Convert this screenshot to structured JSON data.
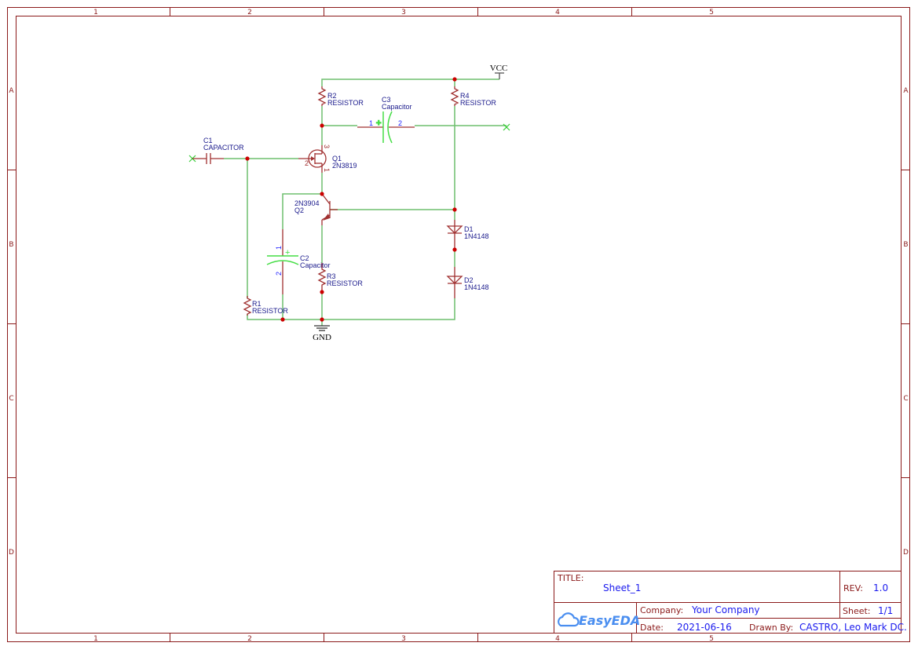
{
  "frame": {
    "columns": [
      "1",
      "2",
      "3",
      "4",
      "5"
    ],
    "rows": [
      "A",
      "B",
      "C",
      "D"
    ]
  },
  "colors": {
    "wire": "#6fbf6f",
    "part": "#a03030",
    "junction": "#cc0000",
    "label": "#1a1a8c",
    "frame": "#8b1a1a"
  },
  "nets": {
    "vcc": "VCC",
    "gnd": "GND"
  },
  "components": {
    "r1": {
      "ref": "R1",
      "value": "RESISTOR"
    },
    "r2": {
      "ref": "R2",
      "value": "RESISTOR"
    },
    "r3": {
      "ref": "R3",
      "value": "RESISTOR"
    },
    "r4": {
      "ref": "R4",
      "value": "RESISTOR"
    },
    "c1": {
      "ref": "C1",
      "value": "CAPACITOR"
    },
    "c2": {
      "ref": "C2",
      "value": "Capacitor",
      "pin1": "1",
      "pin2": "2",
      "plus": "+"
    },
    "c3": {
      "ref": "C3",
      "value": "Capacitor",
      "pin1": "1",
      "pin2": "2",
      "plus": "+"
    },
    "q1": {
      "ref": "Q1",
      "value": "2N3819",
      "pin1": "1",
      "pin2": "2",
      "pin3": "3"
    },
    "q2": {
      "ref": "Q2",
      "value": "2N3904"
    },
    "d1": {
      "ref": "D1",
      "value": "1N4148"
    },
    "d2": {
      "ref": "D2",
      "value": "1N4148"
    }
  },
  "title_block": {
    "title_label": "TITLE:",
    "title": "Sheet_1",
    "rev_label": "REV:",
    "rev": "1.0",
    "company_label": "Company:",
    "company": "Your Company",
    "sheet_label": "Sheet:",
    "sheet": "1/1",
    "date_label": "Date:",
    "date": "2021-06-16",
    "drawn_label": "Drawn By:",
    "drawn_by": "CASTRO, Leo Mark DC.",
    "logo": "EasyEDA"
  }
}
